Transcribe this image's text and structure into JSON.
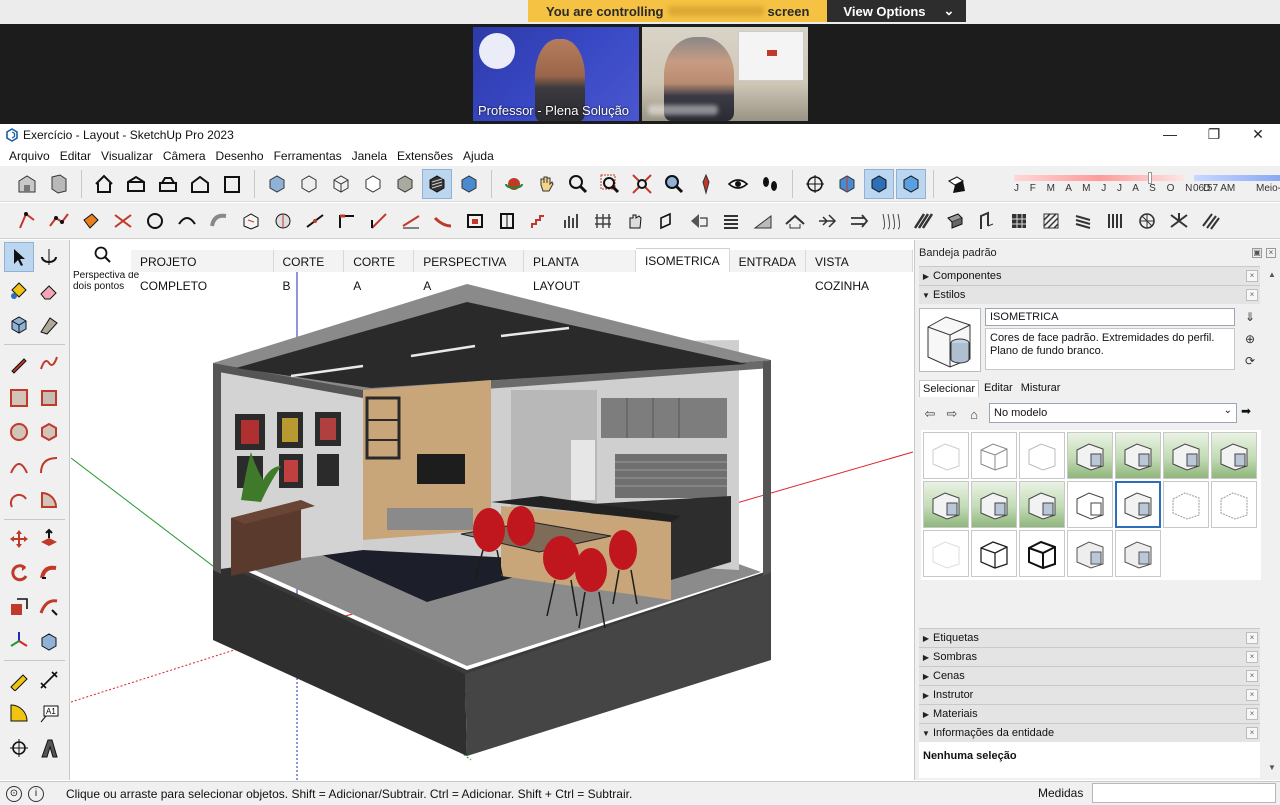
{
  "zoom": {
    "banner_prefix": "You are controlling",
    "banner_suffix": "screen",
    "view_options": "View Options",
    "participants": [
      {
        "name": "Professor - Plena Solução"
      }
    ]
  },
  "window": {
    "title": "Exercício - Layout - SketchUp Pro 2023",
    "minimize": "—",
    "maximize": "❐",
    "close": "✕"
  },
  "menu": [
    "Arquivo",
    "Editar",
    "Visualizar",
    "Câmera",
    "Desenho",
    "Ferramentas",
    "Janela",
    "Extensões",
    "Ajuda"
  ],
  "shadows": {
    "months": "J F M A M J J A S O N D",
    "time": "06:57 AM",
    "noon": "Meio-"
  },
  "viewport": {
    "tool_label": "Perspectiva de dois pontos",
    "scenes": [
      "PROJETO COMPLETO",
      "CORTE B",
      "CORTE A",
      "PERSPECTIVA A",
      "PLANTA LAYOUT",
      "ISOMETRICA",
      "ENTRADA",
      "VISTA COZINHA"
    ],
    "active_scene": "ISOMETRICA"
  },
  "tray": {
    "title": "Bandeja padrão",
    "panels_top": [
      {
        "label": "Componentes",
        "expanded": false
      },
      {
        "label": "Estilos",
        "expanded": true
      }
    ],
    "style": {
      "name": "ISOMETRICA",
      "description": "Cores de face padrão. Extremidades do perfil. Plano de fundo branco.",
      "tabs": [
        "Selecionar",
        "Editar",
        "Misturar"
      ],
      "active_tab": "Selecionar",
      "library": "No modelo"
    },
    "panels_bottom": [
      {
        "label": "Etiquetas",
        "expanded": false
      },
      {
        "label": "Sombras",
        "expanded": false
      },
      {
        "label": "Cenas",
        "expanded": false
      },
      {
        "label": "Instrutor",
        "expanded": false
      },
      {
        "label": "Materiais",
        "expanded": false
      },
      {
        "label": "Informações da entidade",
        "expanded": true
      }
    ],
    "entity_info": "Nenhuma seleção"
  },
  "status": {
    "message": "Clique ou arraste para selecionar objetos. Shift = Adicionar/Subtrair. Ctrl = Adicionar. Shift + Ctrl = Subtrair.",
    "measure_label": "Medidas"
  },
  "colors": {
    "zoom_banner": "#f5c243",
    "selection_blue": "#bcd6ef",
    "axis_red": "#d9232a",
    "axis_green": "#1e9a2e",
    "axis_blue": "#1b2fbd"
  }
}
